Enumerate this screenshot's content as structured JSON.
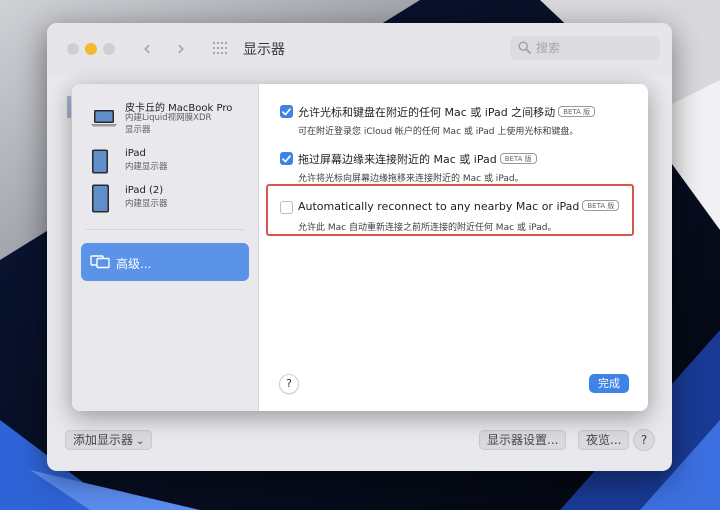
{
  "window": {
    "title": "显示器",
    "search_placeholder": "搜索"
  },
  "bottom_bar": {
    "add_display": "添加显示器",
    "display_settings": "显示器设置...",
    "night_shift": "夜览...",
    "help": "?"
  },
  "sheet": {
    "devices": [
      {
        "name": "皮卡丘的 MacBook Pro",
        "sub": [
          "内建Liquid视网膜XDR",
          "显示器"
        ],
        "icon": "laptop-icon"
      },
      {
        "name": "iPad",
        "sub": [
          "内建显示器"
        ],
        "icon": "tablet-icon"
      },
      {
        "name": "iPad (2)",
        "sub": [
          "内建显示器"
        ],
        "icon": "tablet-icon"
      }
    ],
    "advanced_label": "高级...",
    "options": [
      {
        "title": "允许光标和键盘在附近的任何 Mac 或 iPad 之间移动",
        "badge": "BETA 版",
        "desc": "可在附近登录您 iCloud 帐户的任何 Mac 或 iPad 上使用光标和键盘。",
        "checked": true
      },
      {
        "title": "拖过屏幕边缘来连接附近的 Mac 或 iPad",
        "badge": "BETA 版",
        "desc": "允许将光标向屏幕边缘拖移来连接附近的 Mac 或 iPad。",
        "checked": true
      },
      {
        "title": "Automatically reconnect to any nearby Mac or iPad",
        "badge": "BETA 版",
        "desc": "允许此 Mac 自动重新连接之前所连接的附近任何 Mac 或 iPad。",
        "checked": false
      }
    ],
    "help": "?",
    "done": "完成"
  },
  "colors": {
    "accent": "#3f84e5",
    "sidebar_selected": "#5a93e8",
    "highlight_box": "#d5574e",
    "minimize_light": "#f5b82e"
  }
}
